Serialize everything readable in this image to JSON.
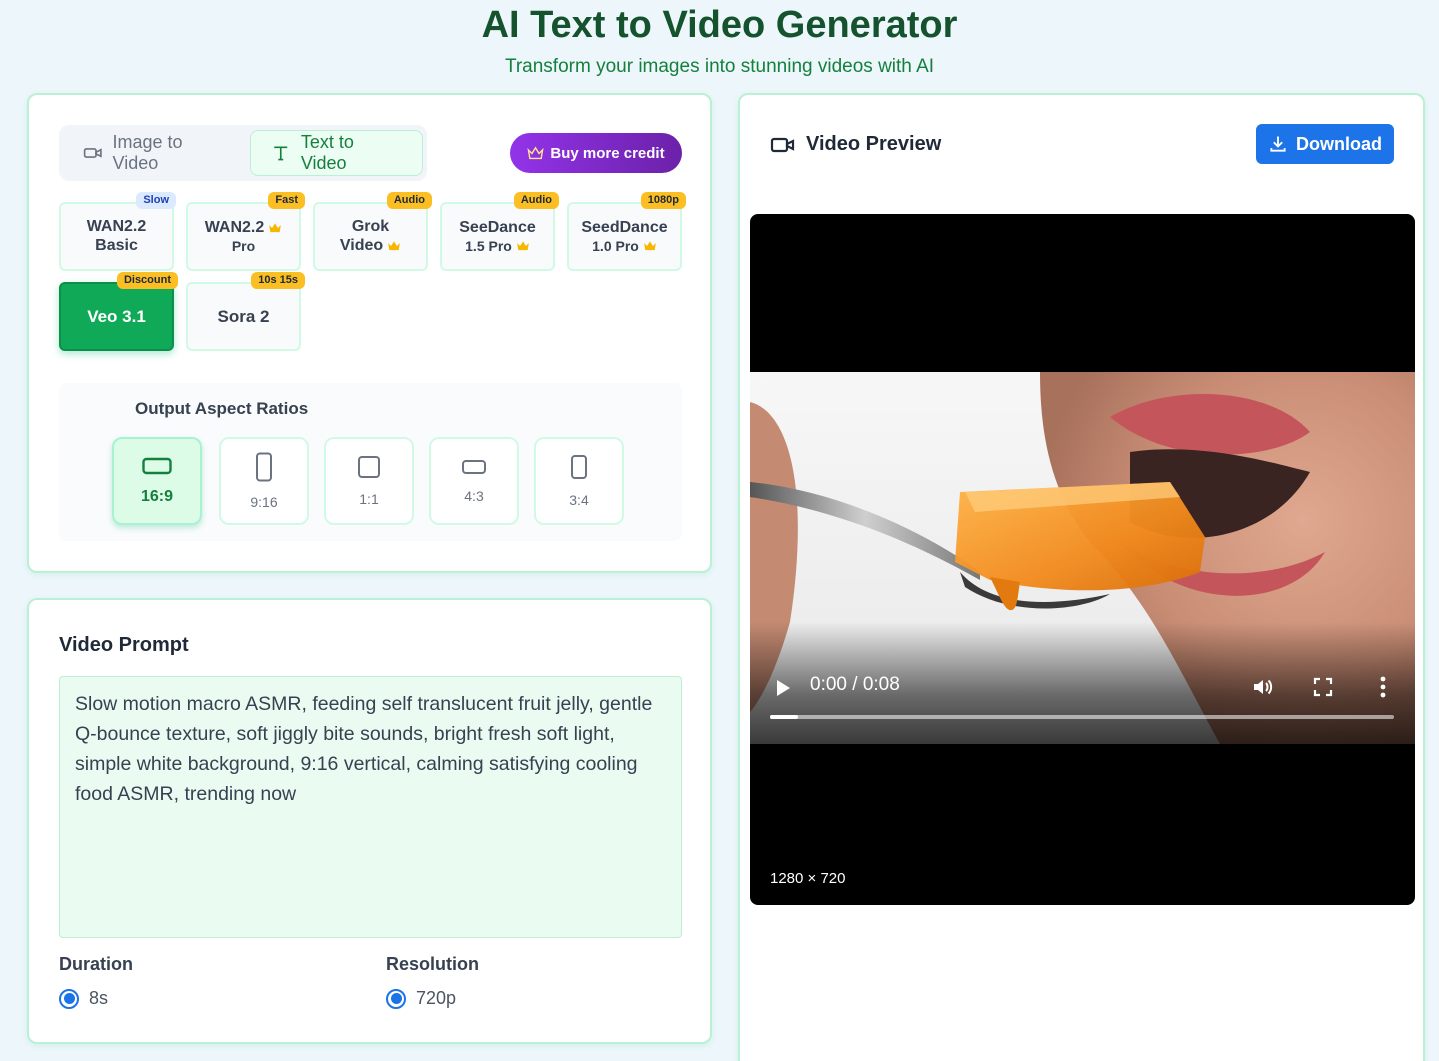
{
  "header": {
    "title": "AI Text to Video Generator",
    "subtitle": "Transform your images into stunning videos with AI"
  },
  "mode_tabs": [
    {
      "label": "Image to Video",
      "icon": "video-camera-icon",
      "active": false
    },
    {
      "label": "Text to Video",
      "icon": "text-t-icon",
      "active": true
    }
  ],
  "buy_credit": {
    "label": "Buy more credit",
    "icon": "crown-icon"
  },
  "models": [
    {
      "line1": "WAN2.2",
      "line2": "Basic",
      "badge": "Slow",
      "premium": false,
      "selected": false
    },
    {
      "line1": "WAN2.2",
      "line2": "Pro",
      "badge": "Fast",
      "premium": true,
      "selected": false
    },
    {
      "line1": "Grok",
      "line2": "Video",
      "badge": "Audio",
      "premium": true,
      "selected": false
    },
    {
      "line1": "SeeDance",
      "line2": "1.5 Pro",
      "badge": "Audio",
      "premium": true,
      "selected": false
    },
    {
      "line1": "SeedDance",
      "line2": "1.0 Pro",
      "badge": "1080p",
      "premium": true,
      "selected": false
    },
    {
      "line1": "Veo 3.1",
      "badge": "Discount",
      "premium": false,
      "selected": true
    },
    {
      "line1": "Sora 2",
      "badge": "10s 15s",
      "premium": false,
      "selected": false
    }
  ],
  "aspect": {
    "title": "Output Aspect Ratios",
    "options": [
      {
        "label": "16:9",
        "selected": true
      },
      {
        "label": "9:16",
        "selected": false
      },
      {
        "label": "1:1",
        "selected": false
      },
      {
        "label": "4:3",
        "selected": false
      },
      {
        "label": "3:4",
        "selected": false
      }
    ]
  },
  "prompt": {
    "title": "Video Prompt",
    "value": "Slow motion macro ASMR, feeding self translucent fruit jelly, gentle Q-bounce texture, soft jiggly bite sounds, bright fresh soft light, simple white background, 9:16 vertical, calming satisfying cooling food ASMR, trending now"
  },
  "duration": {
    "label": "Duration",
    "value": "8s"
  },
  "resolution": {
    "label": "Resolution",
    "value": "720p"
  },
  "preview": {
    "title": "Video Preview",
    "download_label": "Download",
    "time": "0:00 / 0:08",
    "progress": 0.045,
    "dimensions": "1280 × 720"
  },
  "colors": {
    "title_green": "#14532d",
    "accent_green": "#0fa958",
    "buy_purple": "#9333ea",
    "download_blue": "#1d73e8",
    "badge_yellow": "#fbbf24"
  }
}
